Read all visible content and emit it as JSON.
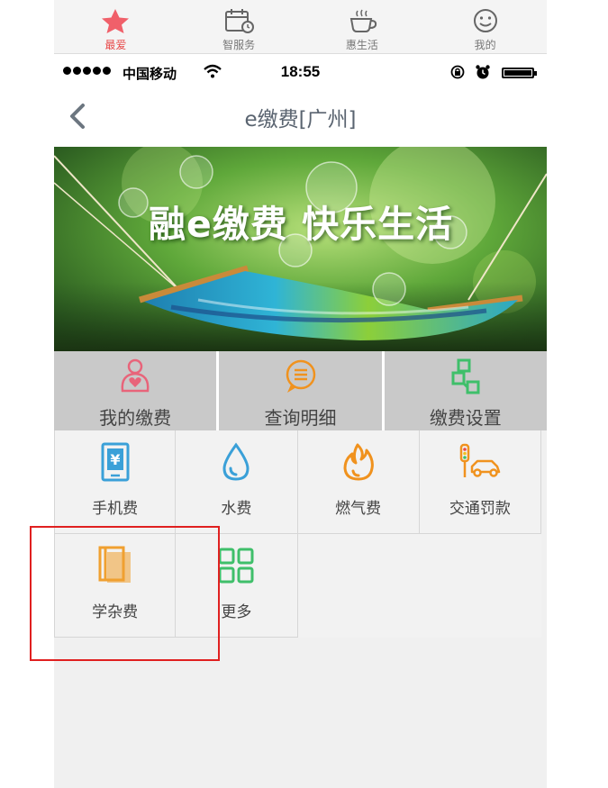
{
  "top_tabs": [
    {
      "label": "最爱",
      "icon": "star-icon",
      "active": true
    },
    {
      "label": "智服务",
      "icon": "calendar-icon",
      "active": false
    },
    {
      "label": "惠生活",
      "icon": "coffee-cup-icon",
      "active": false
    },
    {
      "label": "我的",
      "icon": "smiley-icon",
      "active": false
    }
  ],
  "status_bar": {
    "carrier": "中国移动",
    "time": "18:55"
  },
  "nav": {
    "title": "e缴费[广州]",
    "back_icon": "chevron-left-icon"
  },
  "banner": {
    "slogan": "融e缴费  快乐生活"
  },
  "actions": [
    {
      "label": "我的缴费",
      "icon": "person-heart-icon",
      "color": "#e8647a"
    },
    {
      "label": "查询明细",
      "icon": "chat-lines-icon",
      "color": "#f0921e"
    },
    {
      "label": "缴费设置",
      "icon": "blocks-icon",
      "color": "#3fbf6a"
    }
  ],
  "services": [
    {
      "label": "手机费",
      "icon": "phone-yen-icon",
      "color": "#3aa0d8"
    },
    {
      "label": "水费",
      "icon": "water-drop-icon",
      "color": "#3aa0d8"
    },
    {
      "label": "燃气费",
      "icon": "flame-icon",
      "color": "#f0921e"
    },
    {
      "label": "交通罚款",
      "icon": "traffic-car-icon",
      "color": "#f0921e"
    },
    {
      "label": "学杂费",
      "icon": "books-icon",
      "color": "#f0a030"
    },
    {
      "label": "更多",
      "icon": "grid-more-icon",
      "color": "#3fbf6a"
    }
  ],
  "colors": {
    "accent_red": "#e84a4a",
    "highlight_box": "#e02020",
    "nav_title": "#5a6470"
  }
}
